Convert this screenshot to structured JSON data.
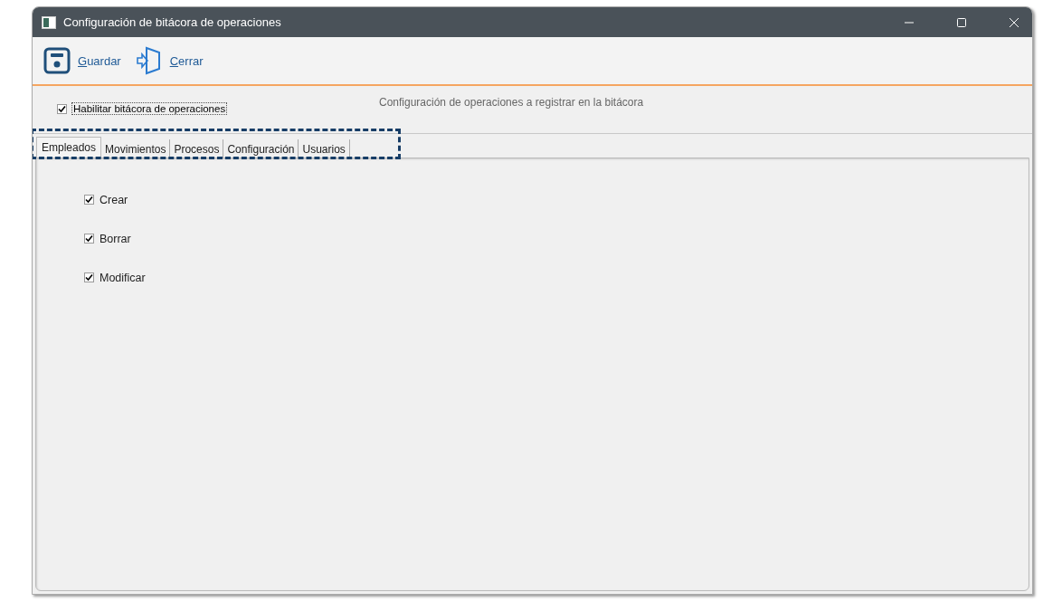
{
  "window": {
    "title": "Configuración de bitácora de operaciones"
  },
  "toolbar": [
    {
      "kind": "save",
      "label": "Guardar"
    },
    {
      "kind": "exit",
      "label": "Cerrar"
    }
  ],
  "enable_log": {
    "label": "Habilitar bitácora de operaciones",
    "checked": true
  },
  "header": "Configuración de operaciones a registrar en la bitácora",
  "tabs": [
    {
      "label": "Empleados",
      "selected": true
    },
    {
      "label": "Movimientos",
      "selected": false
    },
    {
      "label": "Procesos",
      "selected": false
    },
    {
      "label": "Configuración",
      "selected": false
    },
    {
      "label": "Usuarios",
      "selected": false
    }
  ],
  "options": [
    {
      "label": "Crear",
      "checked": true
    },
    {
      "label": "Borrar",
      "checked": true
    },
    {
      "label": "Modificar",
      "checked": true
    }
  ]
}
